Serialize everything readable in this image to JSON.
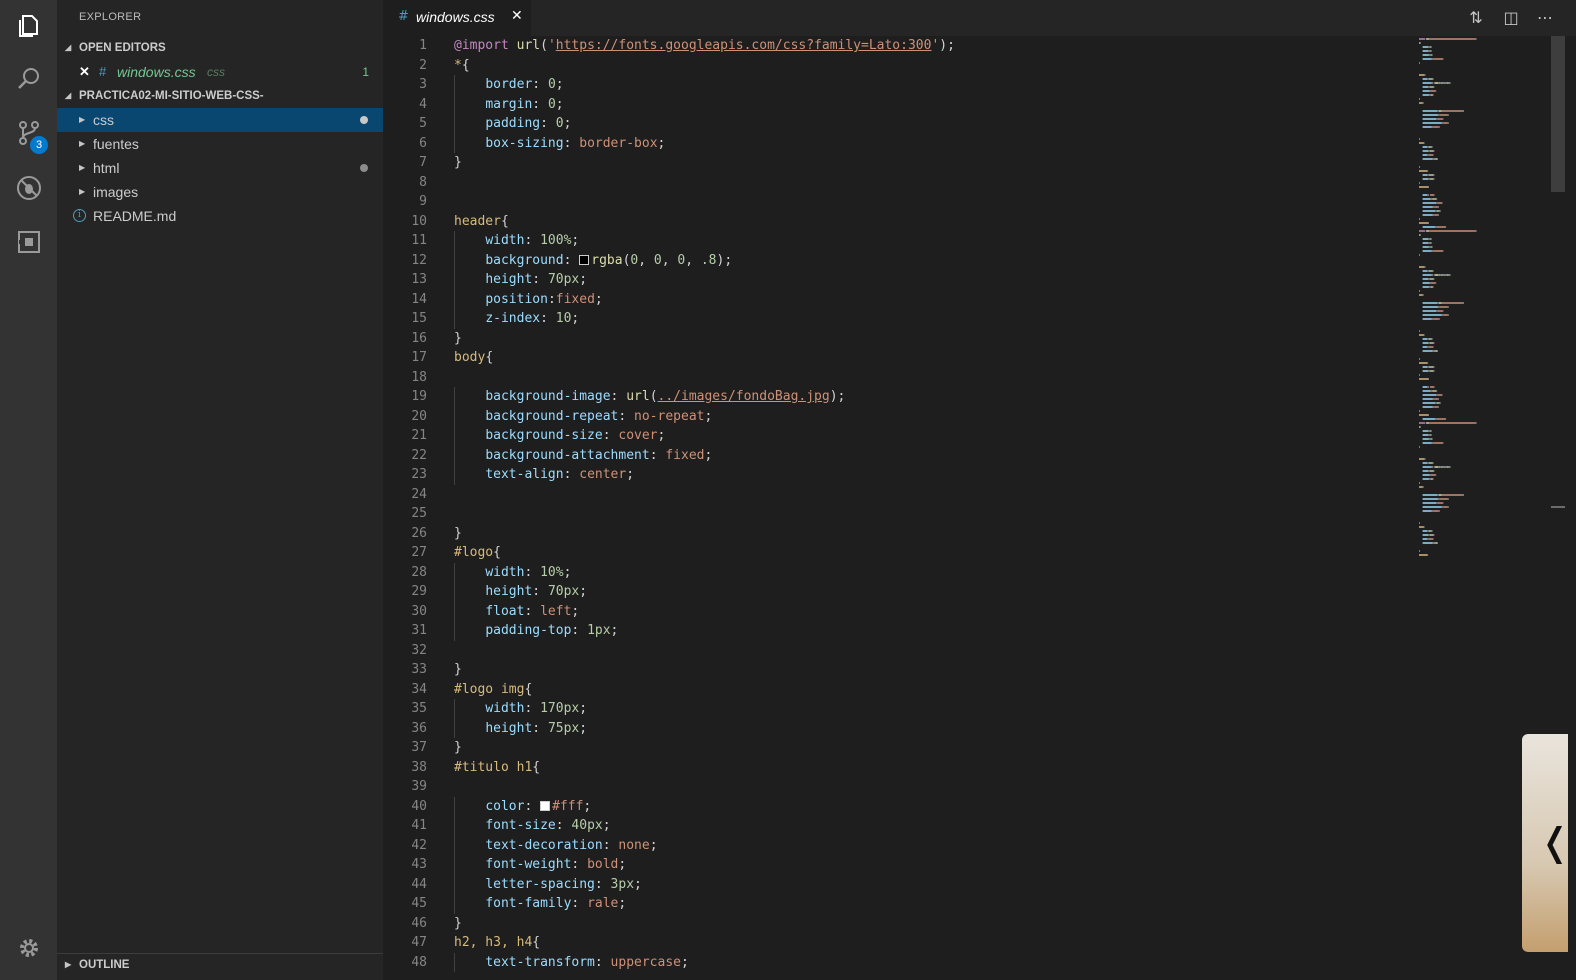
{
  "activity_bar": {
    "icons": [
      "files-icon",
      "search-icon",
      "source-control-icon",
      "debug-icon",
      "extensions-icon",
      "gear-icon"
    ],
    "scm_badge": "3"
  },
  "sidebar": {
    "title": "EXPLORER",
    "open_editors_header": "OPEN EDITORS",
    "open_editor": {
      "name": "windows.css",
      "lang": "css",
      "problems": "1"
    },
    "project_header": "PRACTICA02-MI-SITIO-WEB-CSS-",
    "tree": [
      {
        "label": "css",
        "type": "folder",
        "modified": true,
        "selected": true
      },
      {
        "label": "fuentes",
        "type": "folder",
        "modified": false,
        "selected": false
      },
      {
        "label": "html",
        "type": "folder",
        "modified": true,
        "selected": false
      },
      {
        "label": "images",
        "type": "folder",
        "modified": false,
        "selected": false
      },
      {
        "label": "README.md",
        "type": "file",
        "modified": false,
        "selected": false
      }
    ],
    "outline_header": "OUTLINE"
  },
  "tab": {
    "title": "windows.css"
  },
  "colors": {
    "accent": "#007acc",
    "selection": "#094771",
    "modified_file": "#73c991"
  },
  "editor": {
    "lines": [
      [
        [
          "c-kw",
          "@import"
        ],
        [
          "c-punc",
          " "
        ],
        [
          "c-fn",
          "url"
        ],
        [
          "c-punc",
          "("
        ],
        [
          "c-val",
          "'"
        ],
        [
          "c-link",
          "https://fonts.googleapis.com/css?family=Lato:300"
        ],
        [
          "c-val",
          "'"
        ],
        [
          "c-punc",
          ");"
        ]
      ],
      [
        [
          "c-sel",
          "*"
        ],
        [
          "c-punc",
          "{"
        ]
      ],
      [
        [
          "c-punc",
          "    "
        ],
        [
          "c-prop",
          "border"
        ],
        [
          "c-punc",
          ": "
        ],
        [
          "c-num",
          "0"
        ],
        [
          "c-punc",
          ";"
        ]
      ],
      [
        [
          "c-punc",
          "    "
        ],
        [
          "c-prop",
          "margin"
        ],
        [
          "c-punc",
          ": "
        ],
        [
          "c-num",
          "0"
        ],
        [
          "c-punc",
          ";"
        ]
      ],
      [
        [
          "c-punc",
          "    "
        ],
        [
          "c-prop",
          "padding"
        ],
        [
          "c-punc",
          ": "
        ],
        [
          "c-num",
          "0"
        ],
        [
          "c-punc",
          ";"
        ]
      ],
      [
        [
          "c-punc",
          "    "
        ],
        [
          "c-prop",
          "box-sizing"
        ],
        [
          "c-punc",
          ": "
        ],
        [
          "c-val",
          "border-box"
        ],
        [
          "c-punc",
          ";"
        ]
      ],
      [
        [
          "c-punc",
          "}"
        ]
      ],
      [],
      [],
      [
        [
          "c-sel",
          "header"
        ],
        [
          "c-punc",
          "{"
        ]
      ],
      [
        [
          "c-punc",
          "    "
        ],
        [
          "c-prop",
          "width"
        ],
        [
          "c-punc",
          ": "
        ],
        [
          "c-num",
          "100%"
        ],
        [
          "c-punc",
          ";"
        ]
      ],
      [
        [
          "c-punc",
          "    "
        ],
        [
          "c-prop",
          "background"
        ],
        [
          "c-punc",
          ": "
        ],
        [
          "swatch",
          "#000000"
        ],
        [
          "c-fn",
          "rgba"
        ],
        [
          "c-punc",
          "("
        ],
        [
          "c-num",
          "0"
        ],
        [
          "c-punc",
          ", "
        ],
        [
          "c-num",
          "0"
        ],
        [
          "c-punc",
          ", "
        ],
        [
          "c-num",
          "0"
        ],
        [
          "c-punc",
          ", "
        ],
        [
          "c-num",
          ".8"
        ],
        [
          "c-punc",
          ");"
        ]
      ],
      [
        [
          "c-punc",
          "    "
        ],
        [
          "c-prop",
          "height"
        ],
        [
          "c-punc",
          ": "
        ],
        [
          "c-num",
          "70px"
        ],
        [
          "c-punc",
          ";"
        ]
      ],
      [
        [
          "c-punc",
          "    "
        ],
        [
          "c-prop",
          "position"
        ],
        [
          "c-punc",
          ":"
        ],
        [
          "c-val",
          "fixed"
        ],
        [
          "c-punc",
          ";"
        ]
      ],
      [
        [
          "c-punc",
          "    "
        ],
        [
          "c-prop",
          "z-index"
        ],
        [
          "c-punc",
          ": "
        ],
        [
          "c-num",
          "10"
        ],
        [
          "c-punc",
          ";"
        ]
      ],
      [
        [
          "c-punc",
          "}"
        ]
      ],
      [
        [
          "c-sel",
          "body"
        ],
        [
          "c-punc",
          "{"
        ]
      ],
      [],
      [
        [
          "c-punc",
          "    "
        ],
        [
          "c-prop",
          "background-image"
        ],
        [
          "c-punc",
          ": "
        ],
        [
          "c-fn",
          "url"
        ],
        [
          "c-punc",
          "("
        ],
        [
          "c-link",
          "../images/fondoBag.jpg"
        ],
        [
          "c-punc",
          ");"
        ]
      ],
      [
        [
          "c-punc",
          "    "
        ],
        [
          "c-prop",
          "background-repeat"
        ],
        [
          "c-punc",
          ": "
        ],
        [
          "c-val",
          "no-repeat"
        ],
        [
          "c-punc",
          ";"
        ]
      ],
      [
        [
          "c-punc",
          "    "
        ],
        [
          "c-prop",
          "background-size"
        ],
        [
          "c-punc",
          ": "
        ],
        [
          "c-val",
          "cover"
        ],
        [
          "c-punc",
          ";"
        ]
      ],
      [
        [
          "c-punc",
          "    "
        ],
        [
          "c-prop",
          "background-attachment"
        ],
        [
          "c-punc",
          ": "
        ],
        [
          "c-val",
          "fixed"
        ],
        [
          "c-punc",
          ";"
        ]
      ],
      [
        [
          "c-punc",
          "    "
        ],
        [
          "c-prop",
          "text-align"
        ],
        [
          "c-punc",
          ": "
        ],
        [
          "c-val",
          "center"
        ],
        [
          "c-punc",
          ";"
        ]
      ],
      [],
      [],
      [
        [
          "c-punc",
          "}"
        ]
      ],
      [
        [
          "c-sel",
          "#logo"
        ],
        [
          "c-punc",
          "{"
        ]
      ],
      [
        [
          "c-punc",
          "    "
        ],
        [
          "c-prop",
          "width"
        ],
        [
          "c-punc",
          ": "
        ],
        [
          "c-num",
          "10%"
        ],
        [
          "c-punc",
          ";"
        ]
      ],
      [
        [
          "c-punc",
          "    "
        ],
        [
          "c-prop",
          "height"
        ],
        [
          "c-punc",
          ": "
        ],
        [
          "c-num",
          "70px"
        ],
        [
          "c-punc",
          ";"
        ]
      ],
      [
        [
          "c-punc",
          "    "
        ],
        [
          "c-prop",
          "float"
        ],
        [
          "c-punc",
          ": "
        ],
        [
          "c-val",
          "left"
        ],
        [
          "c-punc",
          ";"
        ]
      ],
      [
        [
          "c-punc",
          "    "
        ],
        [
          "c-prop",
          "padding-top"
        ],
        [
          "c-punc",
          ": "
        ],
        [
          "c-num",
          "1px"
        ],
        [
          "c-punc",
          ";"
        ]
      ],
      [],
      [
        [
          "c-punc",
          "}"
        ]
      ],
      [
        [
          "c-sel",
          "#logo img"
        ],
        [
          "c-punc",
          "{"
        ]
      ],
      [
        [
          "c-punc",
          "    "
        ],
        [
          "c-prop",
          "width"
        ],
        [
          "c-punc",
          ": "
        ],
        [
          "c-num",
          "170px"
        ],
        [
          "c-punc",
          ";"
        ]
      ],
      [
        [
          "c-punc",
          "    "
        ],
        [
          "c-prop",
          "height"
        ],
        [
          "c-punc",
          ": "
        ],
        [
          "c-num",
          "75px"
        ],
        [
          "c-punc",
          ";"
        ]
      ],
      [
        [
          "c-punc",
          "}"
        ]
      ],
      [
        [
          "c-sel",
          "#titulo h1"
        ],
        [
          "c-punc",
          "{"
        ]
      ],
      [],
      [
        [
          "c-punc",
          "    "
        ],
        [
          "c-prop",
          "color"
        ],
        [
          "c-punc",
          ": "
        ],
        [
          "swatch",
          "#ffffff"
        ],
        [
          "c-val",
          "#fff"
        ],
        [
          "c-punc",
          ";"
        ]
      ],
      [
        [
          "c-punc",
          "    "
        ],
        [
          "c-prop",
          "font-size"
        ],
        [
          "c-punc",
          ": "
        ],
        [
          "c-num",
          "40px"
        ],
        [
          "c-punc",
          ";"
        ]
      ],
      [
        [
          "c-punc",
          "    "
        ],
        [
          "c-prop",
          "text-decoration"
        ],
        [
          "c-punc",
          ": "
        ],
        [
          "c-val",
          "none"
        ],
        [
          "c-punc",
          ";"
        ]
      ],
      [
        [
          "c-punc",
          "    "
        ],
        [
          "c-prop",
          "font-weight"
        ],
        [
          "c-punc",
          ": "
        ],
        [
          "c-val",
          "bold"
        ],
        [
          "c-punc",
          ";"
        ]
      ],
      [
        [
          "c-punc",
          "    "
        ],
        [
          "c-prop",
          "letter-spacing"
        ],
        [
          "c-punc",
          ": "
        ],
        [
          "c-num",
          "3px"
        ],
        [
          "c-punc",
          ";"
        ]
      ],
      [
        [
          "c-punc",
          "    "
        ],
        [
          "c-prop",
          "font-family"
        ],
        [
          "c-punc",
          ": "
        ],
        [
          "c-val",
          "rale"
        ],
        [
          "c-punc",
          ";"
        ]
      ],
      [
        [
          "c-punc",
          "}"
        ]
      ],
      [
        [
          "c-sel",
          "h2, h3, h4"
        ],
        [
          "c-punc",
          "{"
        ]
      ],
      [
        [
          "c-punc",
          "    "
        ],
        [
          "c-prop",
          "text-transform"
        ],
        [
          "c-punc",
          ": "
        ],
        [
          "c-val",
          "uppercase"
        ],
        [
          "c-punc",
          ";"
        ]
      ]
    ]
  }
}
